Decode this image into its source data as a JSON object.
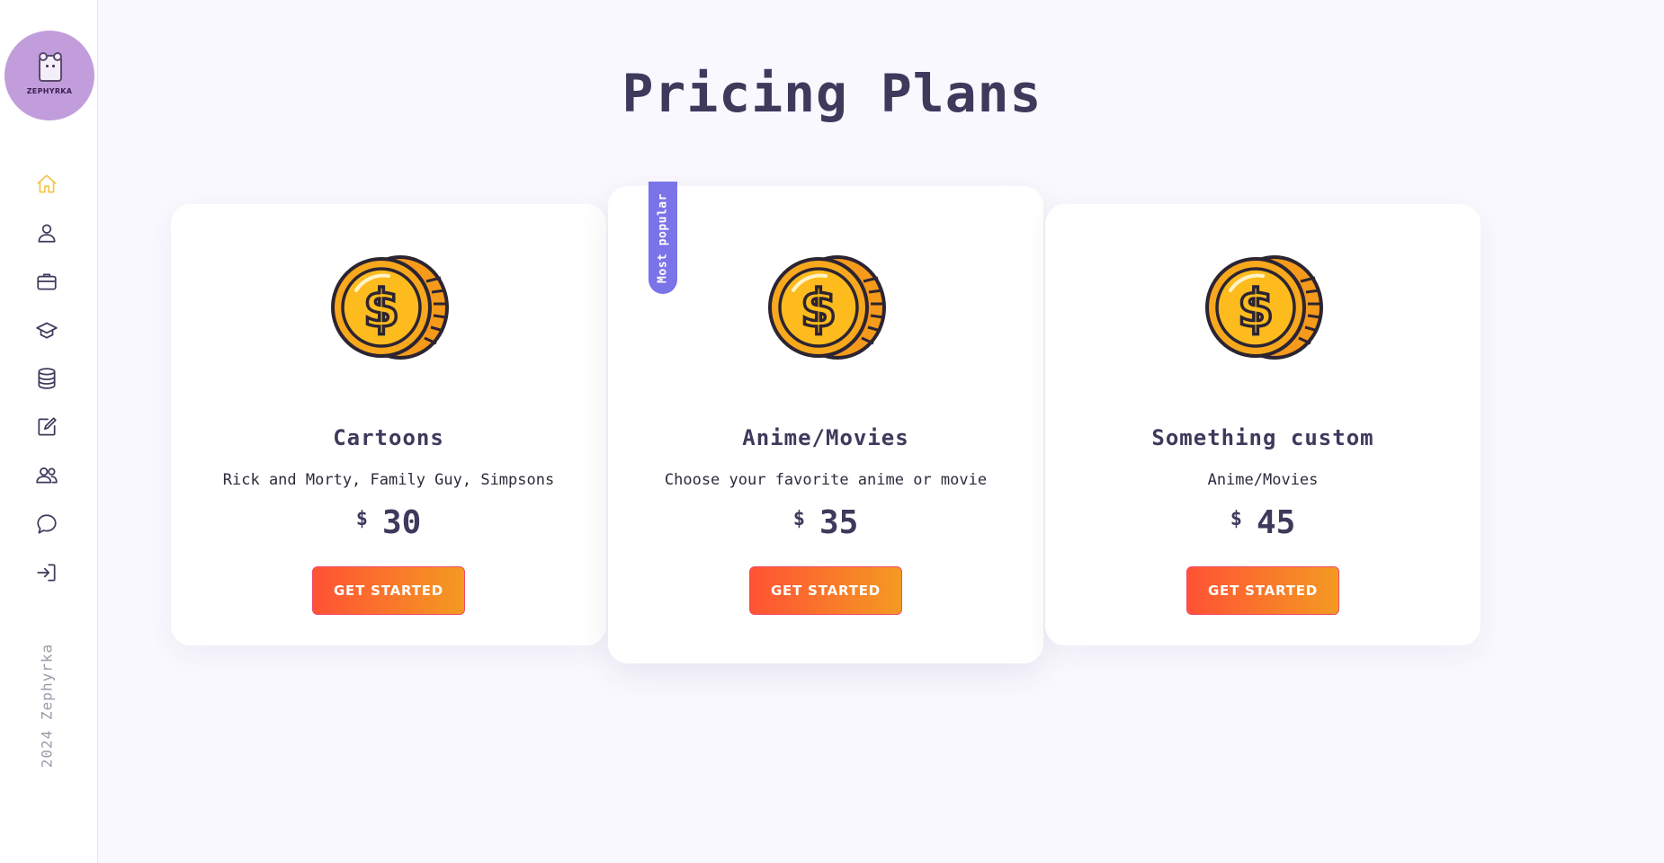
{
  "brand": {
    "logo_text": "ZEPHYRKA"
  },
  "sidebar": {
    "items": [
      {
        "name": "home",
        "icon": "home-icon",
        "active": true
      },
      {
        "name": "profile",
        "icon": "user-icon",
        "active": false
      },
      {
        "name": "portfolio",
        "icon": "briefcase-icon",
        "active": false
      },
      {
        "name": "education",
        "icon": "graduation-cap-icon",
        "active": false
      },
      {
        "name": "database",
        "icon": "database-icon",
        "active": false
      },
      {
        "name": "edit",
        "icon": "edit-icon",
        "active": false
      },
      {
        "name": "team",
        "icon": "users-icon",
        "active": false
      },
      {
        "name": "chat",
        "icon": "chat-icon",
        "active": false
      },
      {
        "name": "login",
        "icon": "login-icon",
        "active": false
      }
    ],
    "copyright": "2024 Zephyrka"
  },
  "page": {
    "title": "Pricing Plans"
  },
  "plans": [
    {
      "name": "Cartoons",
      "description": "Rick and Morty, Family Guy, Simpsons",
      "currency": "$",
      "price": "30",
      "cta": "GET STARTED",
      "popular": false
    },
    {
      "name": "Anime/Movies",
      "description": "Choose your favorite anime or movie",
      "currency": "$",
      "price": "35",
      "cta": "GET STARTED",
      "popular": true,
      "badge": "Most popular"
    },
    {
      "name": "Something custom",
      "description": "Anime/Movies",
      "currency": "$",
      "price": "45",
      "cta": "GET STARTED",
      "popular": false
    }
  ],
  "colors": {
    "background": "#f9f8fe",
    "active_icon": "#f5c64d",
    "badge": "#7b73e8",
    "cta_gradient_start": "#ff5234",
    "cta_gradient_end": "#f49a22",
    "logo_bg": "#c29ddb"
  }
}
